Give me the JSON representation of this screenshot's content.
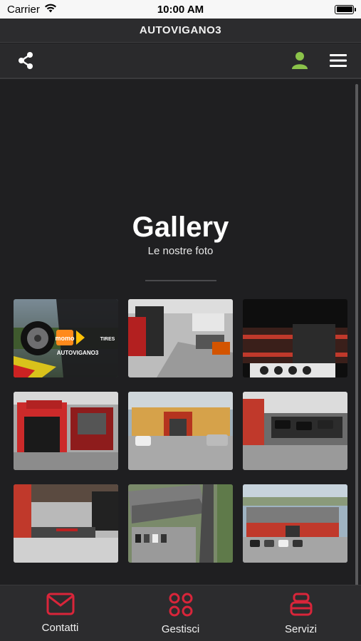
{
  "status_bar": {
    "carrier": "Carrier",
    "time": "10:00 AM"
  },
  "header": {
    "title": "AUTOVIGANO3"
  },
  "toolbar": {
    "share_icon": "share-icon",
    "user_icon": "user-icon",
    "menu_icon": "hamburger-menu-icon",
    "user_color": "#8bc34a"
  },
  "gallery": {
    "title": "Gallery",
    "subtitle": "Le nostre foto",
    "photos": [
      {
        "name": "photo-momo-tires-banner",
        "banner_brand": "momo",
        "banner_tires": "TIRES",
        "banner_name": "AUTOVIGANO3"
      },
      {
        "name": "photo-workshop-interior-tires"
      },
      {
        "name": "photo-tire-storage-racks"
      },
      {
        "name": "photo-shop-entrance"
      },
      {
        "name": "photo-shop-front-parking"
      },
      {
        "name": "photo-workshop-floor"
      },
      {
        "name": "photo-service-bay"
      },
      {
        "name": "photo-aerial-view-road"
      },
      {
        "name": "photo-aerial-view-building"
      }
    ]
  },
  "tabbar": {
    "accent": "#d9253a",
    "tabs": [
      {
        "label": "Contatti",
        "icon": "envelope-icon"
      },
      {
        "label": "Gestisci",
        "icon": "grid-circles-icon"
      },
      {
        "label": "Servizi",
        "icon": "tire-stack-icon"
      }
    ]
  }
}
